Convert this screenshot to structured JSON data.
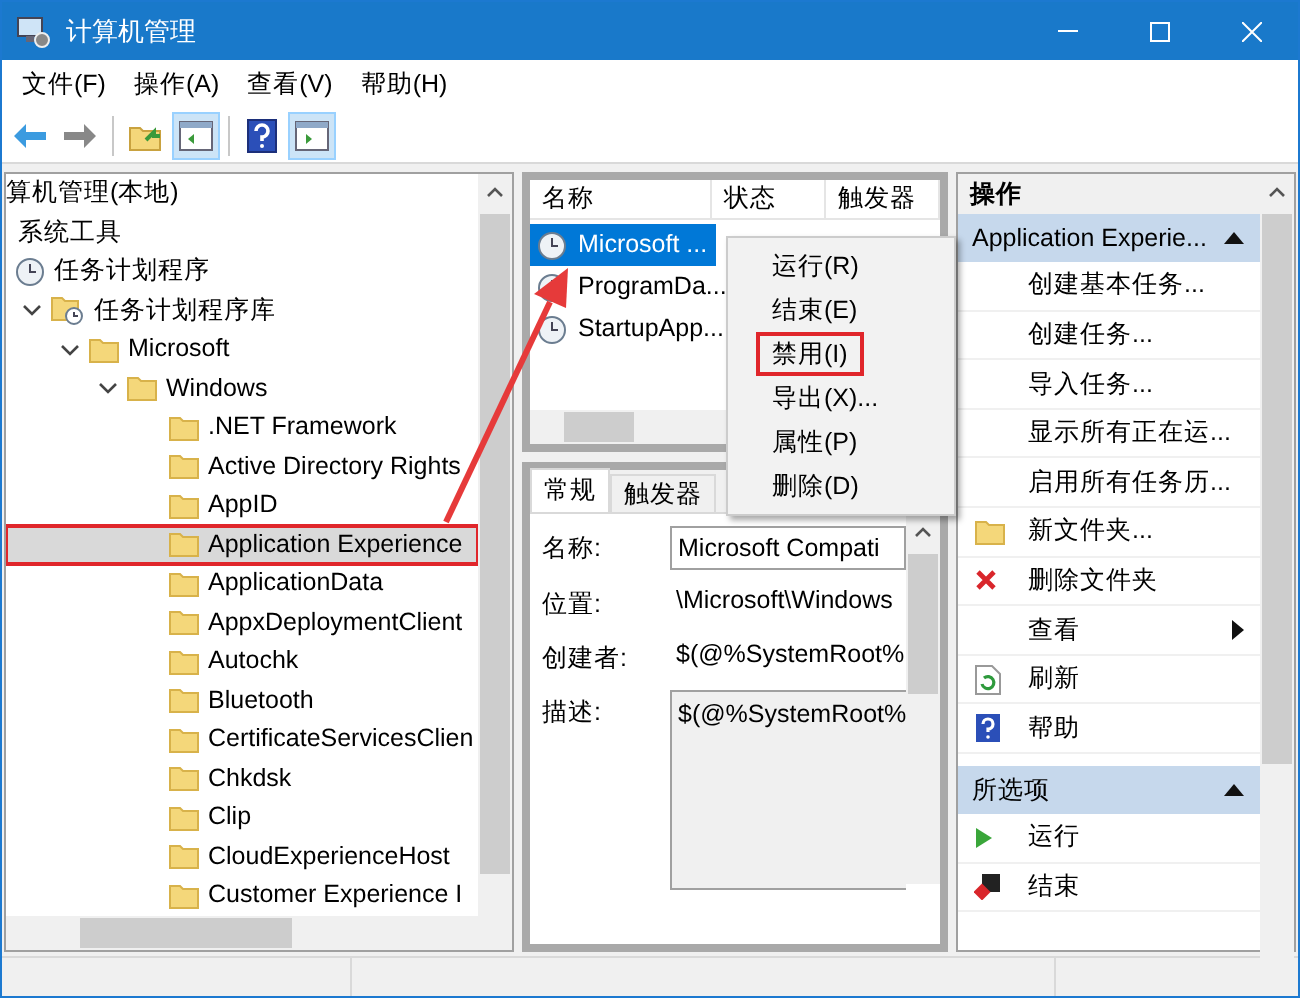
{
  "window": {
    "title": "计算机管理"
  },
  "menu": [
    "文件(F)",
    "操作(A)",
    "查看(V)",
    "帮助(H)"
  ],
  "toolbar": [
    {
      "kind": "back",
      "pressed": false
    },
    {
      "kind": "forward",
      "pressed": false
    },
    {
      "kind": "sep"
    },
    {
      "kind": "up",
      "pressed": false
    },
    {
      "kind": "tree",
      "pressed": true
    },
    {
      "kind": "sep"
    },
    {
      "kind": "help",
      "pressed": false
    },
    {
      "kind": "actions",
      "pressed": true
    }
  ],
  "tree": [
    {
      "label": "算机管理(本地)",
      "selected": false,
      "highlighted": false,
      "children": [
        {
          "label": "系统工具",
          "selected": false,
          "highlighted": false,
          "children": [
            {
              "label": "任务计划程序",
              "kind": "scheduler",
              "selected": false,
              "highlighted": false,
              "children": [
                {
                  "label": "任务计划程序库",
                  "kind": "library",
                  "expanded": true,
                  "selected": false,
                  "highlighted": false,
                  "children": [
                    {
                      "label": "Microsoft",
                      "kind": "folder",
                      "expanded": true,
                      "selected": false,
                      "highlighted": false,
                      "children": [
                        {
                          "label": "Windows",
                          "kind": "folder",
                          "expanded": true,
                          "selected": false,
                          "highlighted": false,
                          "children": [
                            {
                              "label": ".NET Framework",
                              "kind": "folder",
                              "selected": false,
                              "highlighted": false
                            },
                            {
                              "label": "Active Directory Rights",
                              "kind": "folder",
                              "selected": false,
                              "highlighted": false
                            },
                            {
                              "label": "AppID",
                              "kind": "folder",
                              "selected": false,
                              "highlighted": false
                            },
                            {
                              "label": "Application Experience",
                              "kind": "folder",
                              "selected": true,
                              "highlighted": true
                            },
                            {
                              "label": "ApplicationData",
                              "kind": "folder",
                              "selected": false,
                              "highlighted": false
                            },
                            {
                              "label": "AppxDeploymentClient",
                              "kind": "folder",
                              "selected": false,
                              "highlighted": false
                            },
                            {
                              "label": "Autochk",
                              "kind": "folder",
                              "selected": false,
                              "highlighted": false
                            },
                            {
                              "label": "Bluetooth",
                              "kind": "folder",
                              "selected": false,
                              "highlighted": false
                            },
                            {
                              "label": "CertificateServicesClien",
                              "kind": "folder",
                              "selected": false,
                              "highlighted": false
                            },
                            {
                              "label": "Chkdsk",
                              "kind": "folder",
                              "selected": false,
                              "highlighted": false
                            },
                            {
                              "label": "Clip",
                              "kind": "folder",
                              "selected": false,
                              "highlighted": false
                            },
                            {
                              "label": "CloudExperienceHost",
                              "kind": "folder",
                              "selected": false,
                              "highlighted": false
                            },
                            {
                              "label": "Customer Experience I",
                              "kind": "folder",
                              "selected": false,
                              "highlighted": false
                            }
                          ]
                        }
                      ]
                    }
                  ]
                }
              ]
            }
          ]
        }
      ]
    }
  ],
  "tasks": {
    "columns": [
      "名称",
      "状态",
      "触发器"
    ],
    "rows": [
      {
        "name": "Microsoft ...",
        "selected": true
      },
      {
        "name": "ProgramDa...",
        "selected": false
      },
      {
        "name": "StartupApp...",
        "selected": false
      }
    ]
  },
  "context_menu": [
    {
      "label": "运行(R)",
      "highlighted": false
    },
    {
      "label": "结束(E)",
      "highlighted": false
    },
    {
      "label": "禁用(I)",
      "highlighted": true
    },
    {
      "label": "导出(X)...",
      "highlighted": false
    },
    {
      "label": "属性(P)",
      "highlighted": false
    },
    {
      "label": "删除(D)",
      "highlighted": false
    }
  ],
  "detail_tabs": [
    {
      "label": "常规",
      "selected": true
    },
    {
      "label": "触发器",
      "selected": false
    }
  ],
  "fields": [
    {
      "label": "名称:",
      "value": "Microsoft Compati",
      "kind": "input"
    },
    {
      "label": "位置:",
      "value": "\\Microsoft\\Windows",
      "kind": "text"
    },
    {
      "label": "创建者:",
      "value": "$(@%SystemRoot%",
      "kind": "text"
    },
    {
      "label": "描述:",
      "value": "$(@%SystemRoot%",
      "kind": "textarea"
    }
  ],
  "actions": {
    "title": "操作",
    "sections": [
      {
        "title": "Application Experie...",
        "items": [
          {
            "label": "创建基本任务...",
            "kind": "plain"
          },
          {
            "label": "创建任务...",
            "kind": "plain"
          },
          {
            "label": "导入任务...",
            "kind": "plain"
          },
          {
            "label": "显示所有正在运...",
            "kind": "plain"
          },
          {
            "label": "启用所有任务历...",
            "kind": "plain"
          },
          {
            "label": "新文件夹...",
            "kind": "folder"
          },
          {
            "label": "删除文件夹",
            "kind": "delete"
          },
          {
            "label": "查看",
            "kind": "submenu"
          },
          {
            "label": "刷新",
            "kind": "refresh"
          },
          {
            "label": "帮助",
            "kind": "help"
          }
        ]
      },
      {
        "title": "所选项",
        "items": [
          {
            "label": "运行",
            "kind": "run"
          },
          {
            "label": "结束",
            "kind": "stop"
          }
        ]
      }
    ]
  }
}
